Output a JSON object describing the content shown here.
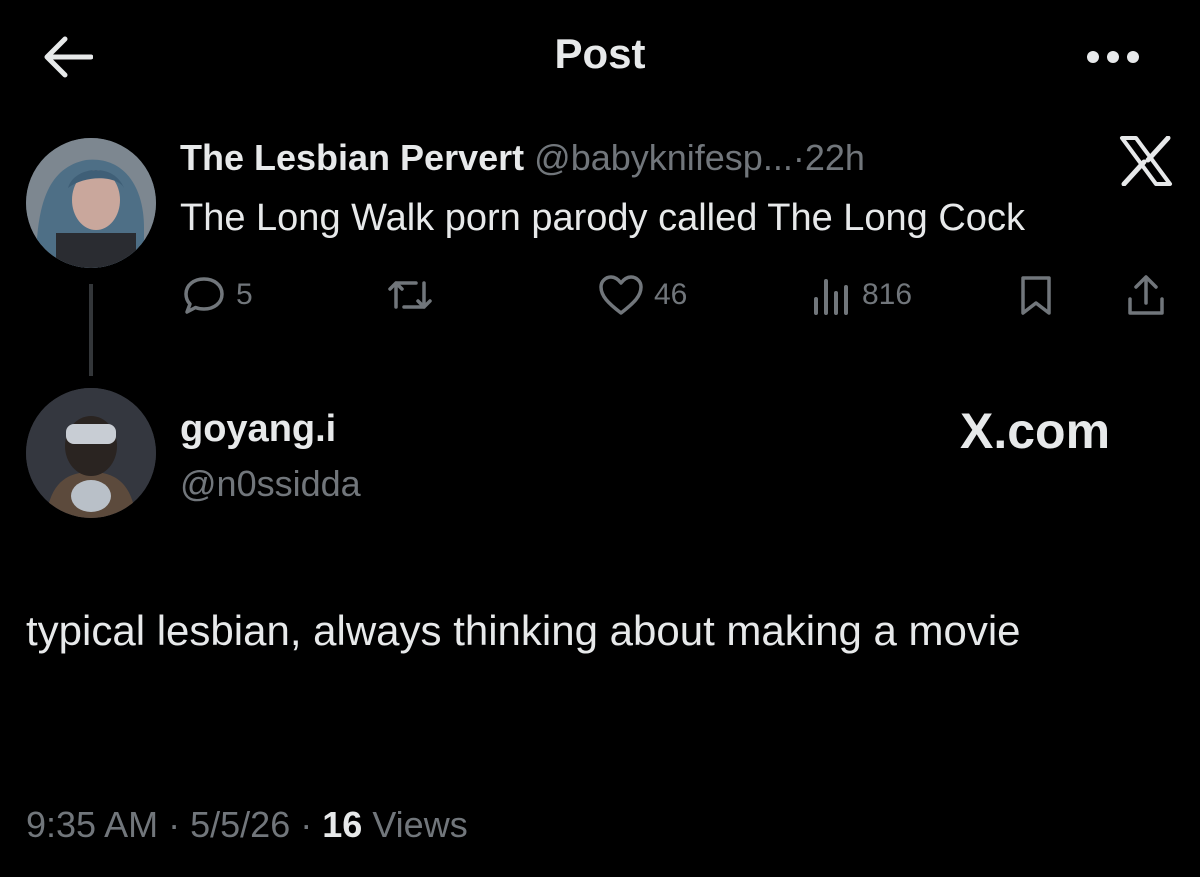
{
  "header": {
    "title": "Post",
    "back_icon": "arrow-left-icon",
    "more_icon": "ellipsis-icon"
  },
  "quoted_post": {
    "author_name": "The Lesbian Pervert",
    "author_handle": "@babyknifesp...",
    "separator": "·",
    "age": "22h",
    "text": "The Long Walk porn parody called The Long Cock",
    "metrics": {
      "replies": "5",
      "likes": "46",
      "views": "816"
    }
  },
  "reply_post": {
    "author_name": "goyang.i",
    "author_handle": "@n0ssidda",
    "text": "typical lesbian, always thinking about making a movie",
    "time": "9:35 AM",
    "sep1": "·",
    "date": "5/5/26",
    "sep2": "·",
    "views_count": "16",
    "views_label": "Views"
  },
  "watermark": {
    "text": "X.com"
  },
  "colors": {
    "background": "#000000",
    "primary_text": "#e7e9ea",
    "secondary_text": "#71767b",
    "thread_line": "#333639"
  }
}
